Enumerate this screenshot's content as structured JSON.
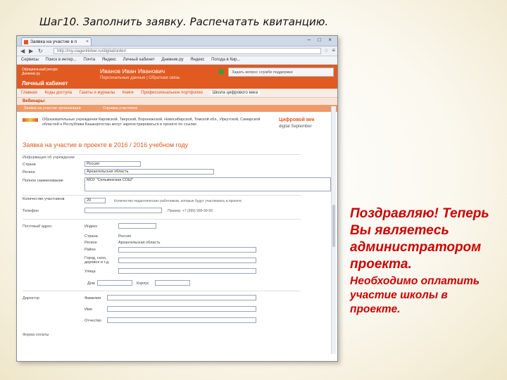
{
  "slide": {
    "title": "Шаг10.  Заполнить заявку. Распечатать квитанцию."
  },
  "browser": {
    "tab_title": "Заявка на участие в п",
    "tab_close": "×",
    "window_controls": "– □ ×",
    "url": "http://my.ciagentinber.ru/digital/order/",
    "star_icon": "☆",
    "menu_icon": "≡",
    "bookmarks": [
      "Сервисы",
      "Поиск в интер...",
      "Почта",
      "Яндекс",
      "Личный кабинет",
      "Дневник.ру",
      "Яндекс",
      "Погода в Кир..."
    ]
  },
  "site": {
    "logo_small": "Официальный ресурс Дневник.ру",
    "logo_title": "Личный кабинет",
    "user_name": "Иванов Иван Иванович",
    "user_links": "Персональные данные  |  Обратная связь",
    "question_box": "Задать вопрос службе поддержки",
    "main_nav": [
      "Главная",
      "Коды доступа",
      "Газеты и журналы",
      "Книги",
      "Профессиональное портфолио",
      "Школа цифрового века"
    ],
    "active_nav_index": 5,
    "webinar_label": "Вебинары:",
    "subnav": [
      "Заявка на участие организации",
      "Справка участника"
    ]
  },
  "form": {
    "info_text": "Образовательные учреждения Кировской, Тверской, Воронежской, Новосибирской, Томской обл., Иркутской, Самарской областей и Республики Башкортостан могут зарегистрироваться в проекте по ссылке",
    "side_promo_title": "Цифровой век",
    "side_promo_sub": "digital September",
    "title": "Заявка на участие в проекте в 2016 / 2016 учебном году",
    "section_org": "Информация об учреждении",
    "label_country": "Страна",
    "value_country": "Россия",
    "label_region": "Регион",
    "value_region": "Архангельская область",
    "label_fullname": "Полное наименование",
    "value_fullname": "МОУ \"Сельмекская СОШ\"",
    "label_count": "Количество участников",
    "value_count": "20",
    "hint_count": "Количество педагогических работников, которые будут участвовать в проекте",
    "label_phone": "Телефон",
    "hint_phone": "Пример: +7 (999) 999-99-99",
    "section_address": "Почтовый адрес",
    "label_index": "Индекс",
    "label_addr_country": "Страна",
    "value_addr_country": "Россия",
    "label_addr_region": "Регион",
    "value_addr_region": "Архангельская область",
    "label_district": "Район",
    "label_city": "Город, село, деревня и т.д.",
    "label_street": "Улица",
    "label_house": "Дом",
    "label_building": "Корпус",
    "section_director": "Директор",
    "label_surname": "Фамилия",
    "label_name": "Имя",
    "label_patronymic": "Отчество",
    "section_payment": "Форма оплаты"
  },
  "message": {
    "main": "Поздравляю! Теперь Вы являетесь администратором проекта.",
    "sub": "Необходимо оплатить участие школы в проекте."
  }
}
